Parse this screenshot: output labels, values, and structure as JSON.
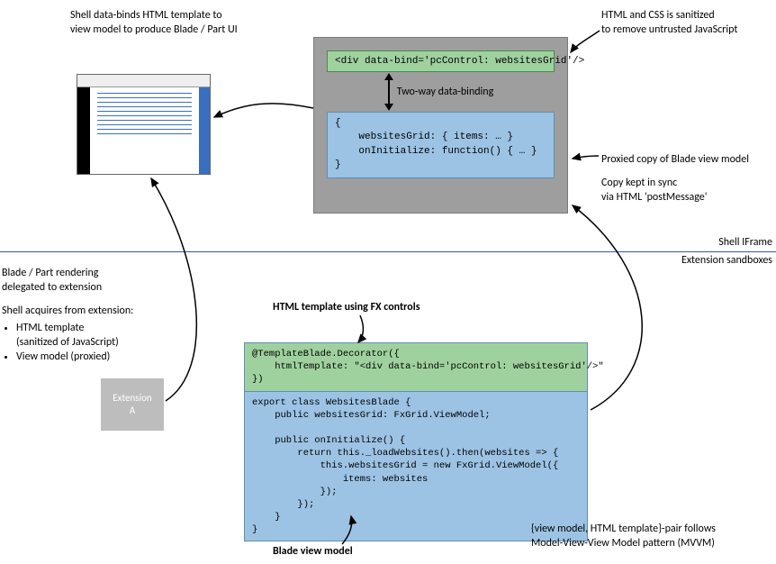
{
  "captions": {
    "shell_binds": "Shell data-binds HTML template to\nview model to produce Blade / Part UI",
    "sanitize": "HTML and CSS is sanitized\nto remove untrusted JavaScript",
    "two_way": "Two-way data-binding",
    "proxied": "Proxied copy of Blade view model",
    "sync": "Copy kept in sync\nvia HTML 'postMessage'",
    "shell_iframe": "Shell IFrame",
    "ext_sandboxes": "Extension sandboxes",
    "delegated": "Blade / Part rendering\ndelegated to extension",
    "acquires_intro": "Shell acquires from extension:",
    "acquires_bullets": [
      "HTML template\n(sanitized of JavaScript)",
      "View model (proxied)"
    ],
    "extension_a": "Extension\nA",
    "fx_heading": "HTML template using FX controls",
    "blade_vm": "Blade view model",
    "mvvm": "{view model, HTML template}-pair follows\nModel-View-View Model pattern (MVVM)"
  },
  "code": {
    "top_green": "<div data-bind='pcControl: websitesGrid'/>",
    "top_blue": "{\n    websitesGrid: { items: … }\n    onInitialize: function() { … }\n}",
    "bottom_green": "@TemplateBlade.Decorator({\n    htmlTemplate: \"<div data-bind='pcControl: websitesGrid'/>\"\n})",
    "bottom_blue": "export class WebsitesBlade {\n    public websitesGrid: FxGrid.ViewModel;\n\n    public onInitialize() {\n        return this._loadWebsites().then(websites => {\n            this.websitesGrid = new FxGrid.ViewModel({\n                items: websites\n            });\n        });\n    }\n}"
  }
}
